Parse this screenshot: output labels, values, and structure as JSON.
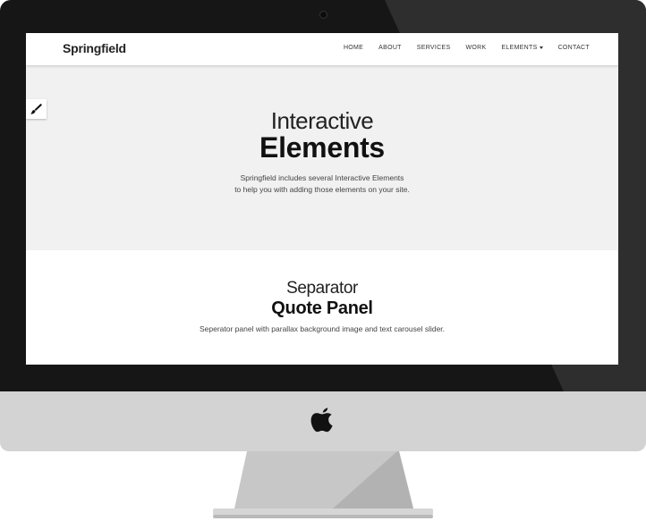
{
  "navbar": {
    "brand": "Springfield",
    "items": [
      {
        "label": "HOME"
      },
      {
        "label": "ABOUT"
      },
      {
        "label": "SERVICES"
      },
      {
        "label": "WORK"
      },
      {
        "label": "ELEMENTS"
      },
      {
        "label": "CONTACT"
      }
    ]
  },
  "hero": {
    "title_light": "Interactive",
    "title_bold": "Elements",
    "desc_line1": "Springfield includes several Interactive Elements",
    "desc_line2": "to help you with adding those elements on your site."
  },
  "section": {
    "title_light": "Separator",
    "title_bold": "Quote Panel",
    "desc": "Seperator panel with parallax background image and text carousel slider."
  },
  "icons": {
    "customizer": "paintbrush-icon",
    "device_logo": "apple-logo-icon",
    "dropdown": "caret-down-icon"
  },
  "colors": {
    "bezel": "#161616",
    "chin": "#d3d3d3",
    "hero_bg": "#f1f1f1"
  }
}
